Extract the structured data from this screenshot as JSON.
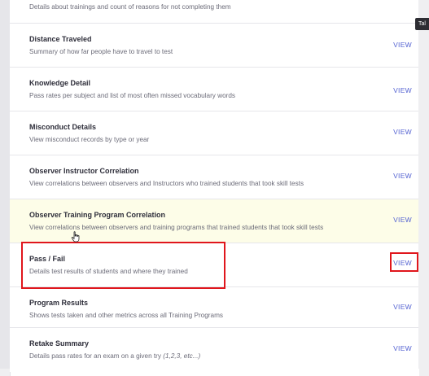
{
  "tooltip_text": "Tal",
  "reports": [
    {
      "title": "",
      "description": "Details about trainings and count of reasons for not completing them",
      "view_label": ""
    },
    {
      "title": "Distance Traveled",
      "description": "Summary of how far people have to travel to test",
      "view_label": "VIEW"
    },
    {
      "title": "Knowledge Detail",
      "description": "Pass rates per subject and list of most often missed vocabulary words",
      "view_label": "VIEW"
    },
    {
      "title": "Misconduct Details",
      "description": "View misconduct records by type or year",
      "view_label": "VIEW"
    },
    {
      "title": "Observer Instructor Correlation",
      "description": "View correlations between observers and Instructors who trained students that took skill tests",
      "view_label": "VIEW"
    },
    {
      "title": "Observer Training Program Correlation",
      "description": "View correlations between observers and training programs that trained students that took skill tests",
      "view_label": "VIEW"
    },
    {
      "title": "Pass / Fail",
      "description": "Details test results of students and where they trained",
      "view_label": "VIEW"
    },
    {
      "title": "Program Results",
      "description": "Shows tests taken and other metrics across all Training Programs",
      "view_label": "VIEW"
    },
    {
      "title": "Retake Summary",
      "description": "Details pass rates for an exam on a given try ",
      "description_italic": "(1,2,3, etc...)",
      "view_label": "VIEW"
    }
  ],
  "colors": {
    "link": "#5664d2",
    "highlight_row": "#fdfde8",
    "annotation": "#e0161c"
  },
  "icons": [
    "hand-pointer-cursor-icon"
  ]
}
